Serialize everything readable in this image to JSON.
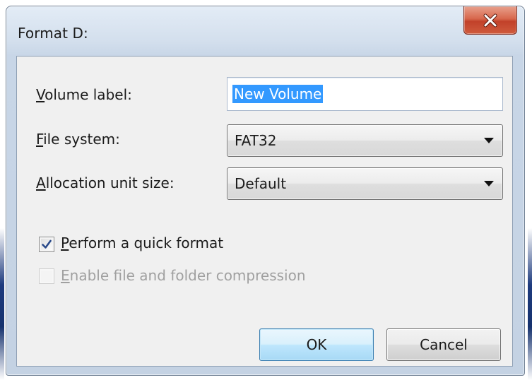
{
  "window": {
    "title": "Format D:",
    "close_label": "X"
  },
  "form": {
    "volume_label": {
      "label_mnemonic": "V",
      "label_rest": "olume label:",
      "value": "New Volume"
    },
    "file_system": {
      "label_mnemonic": "F",
      "label_rest": "ile system:",
      "value": "FAT32"
    },
    "allocation_unit_size": {
      "label_mnemonic": "A",
      "label_rest": "llocation unit size:",
      "value": "Default"
    }
  },
  "options": {
    "quick_format": {
      "label_mnemonic": "P",
      "label_rest": "erform a quick format",
      "checked": true,
      "enabled": true
    },
    "compression": {
      "label_mnemonic": "E",
      "label_rest": "nable file and folder compression",
      "checked": false,
      "enabled": false
    }
  },
  "buttons": {
    "ok_label": "OK",
    "cancel_label": "Cancel"
  },
  "colors": {
    "selection_highlight": "#3399ff",
    "close_button": "#c7452d",
    "default_button_border": "#3c7fb1"
  }
}
